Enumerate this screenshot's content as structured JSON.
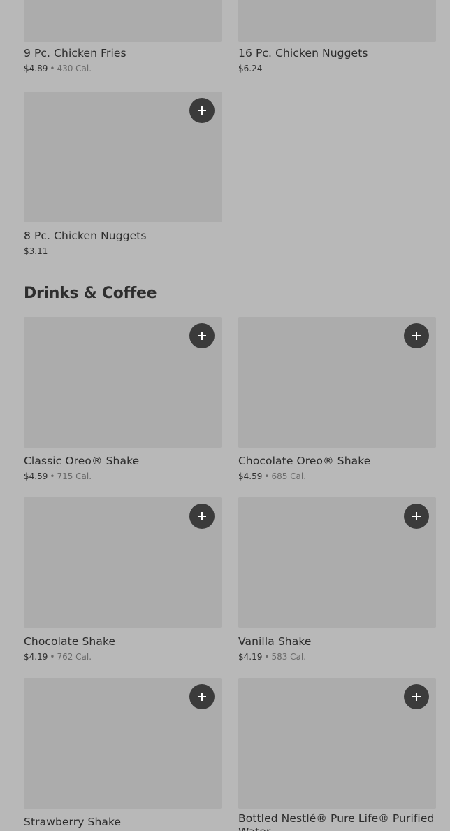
{
  "items_top": [
    {
      "name": "9 Pc. Chicken Fries",
      "price": "$4.89",
      "calories": "430 Cal."
    },
    {
      "name": "16 Pc. Chicken Nuggets",
      "price": "$6.24",
      "calories": ""
    },
    {
      "name": "8 Pc. Chicken Nuggets",
      "price": "$3.11",
      "calories": ""
    }
  ],
  "drinks_section": {
    "title": "Drinks & Coffee",
    "items": [
      {
        "name": "Classic Oreo® Shake",
        "price": "$4.59",
        "calories": "715 Cal."
      },
      {
        "name": "Chocolate Oreo® Shake",
        "price": "$4.59",
        "calories": "685 Cal."
      },
      {
        "name": "Chocolate Shake",
        "price": "$4.19",
        "calories": "762 Cal."
      },
      {
        "name": "Vanilla Shake",
        "price": "$4.19",
        "calories": "583 Cal."
      },
      {
        "name": "Strawberry Shake",
        "price": "",
        "calories": ""
      },
      {
        "name": "Bottled Nestlé® Pure Life® Purified Water",
        "price": "",
        "calories": ""
      }
    ]
  },
  "separator": "•",
  "icons": {
    "add_button": "plus-icon"
  },
  "colors": {
    "background": "#b8b8b8",
    "image_placeholder": "#acacac",
    "add_button": "#3b3b3b"
  }
}
